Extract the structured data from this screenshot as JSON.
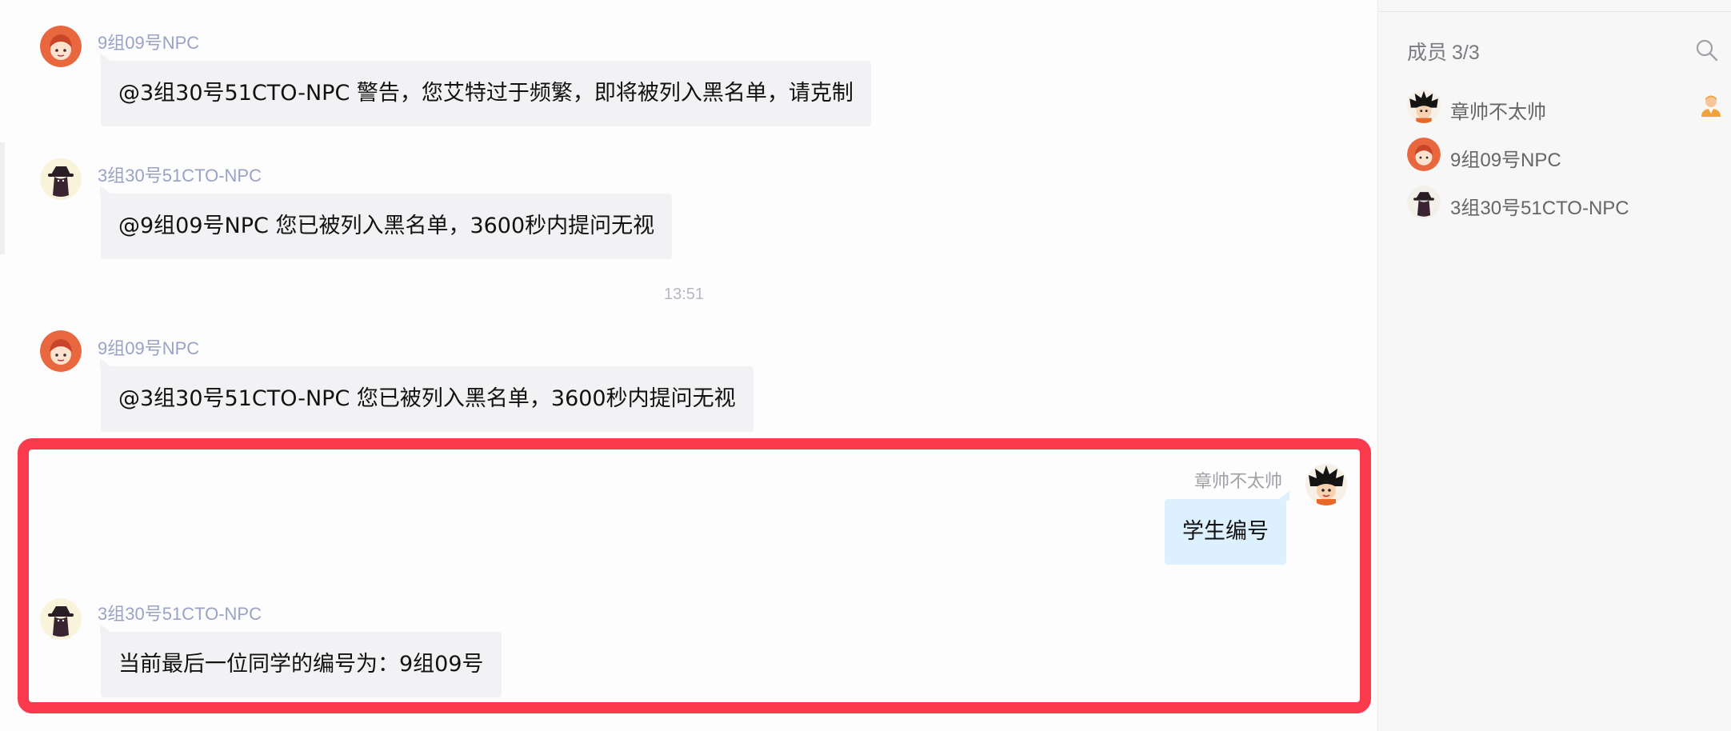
{
  "chat": {
    "messages": [
      {
        "sender": "9组09号NPC",
        "text": "@3组30号51CTO-NPC 警告，您艾特过于频繁，即将被列入黑名单，请克制",
        "avatar": "girl-avatar"
      },
      {
        "sender": "3组30号51CTO-NPC",
        "text": "@9组09号NPC 您已被列入黑名单，3600秒内提问无视",
        "avatar": "dark-figure-avatar"
      },
      {
        "sender": "9组09号NPC",
        "text": "@3组30号51CTO-NPC 您已被列入黑名单，3600秒内提问无视",
        "avatar": "girl-avatar"
      },
      {
        "sender": "章帅不太帅",
        "text": "学生编号",
        "avatar": "goku-avatar"
      },
      {
        "sender": "3组30号51CTO-NPC",
        "text": "当前最后一位同学的编号为：9组09号",
        "avatar": "dark-figure-avatar"
      }
    ],
    "timestamp": "13:51"
  },
  "sidebar": {
    "members_label": "成员",
    "members_count": "3/3",
    "search_icon": "search-icon",
    "members": [
      {
        "name": "章帅不太帅",
        "avatar": "goku-avatar",
        "badge": "owner-icon"
      },
      {
        "name": "9组09号NPC",
        "avatar": "girl-avatar"
      },
      {
        "name": "3组30号51CTO-NPC",
        "avatar": "dark-figure-avatar"
      }
    ]
  },
  "colors": {
    "highlight": "#fa3a4d",
    "self_bubble": "#dcf1fd",
    "bubble": "#f2f2f4",
    "sender_name": "#98a3c7"
  }
}
